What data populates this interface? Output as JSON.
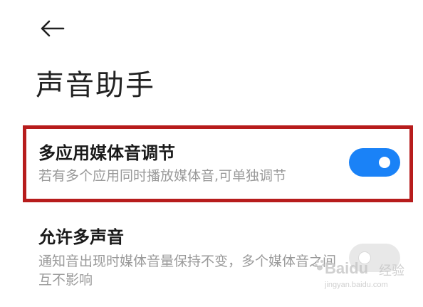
{
  "header": {
    "back_icon": "arrow-left-icon",
    "title": "声音助手"
  },
  "settings": [
    {
      "title": "多应用媒体音调节",
      "description": "若有多个应用同时播放媒体音,可单独调节",
      "enabled": true,
      "highlighted": true
    },
    {
      "title": "允许多声音",
      "description": "通知音出现时媒体音量保持不变，多个媒体音之间互不影响",
      "enabled": false,
      "highlighted": false
    }
  ],
  "watermark": {
    "brand": "Baidu",
    "suffix": "经验",
    "url": "jingyan.baidu.com"
  },
  "colors": {
    "toggle_on": "#1a82f7",
    "toggle_off": "#e8e8e8",
    "highlight_border": "#b71c1c",
    "title_text": "#222222",
    "description_text": "#9a9a9a"
  }
}
